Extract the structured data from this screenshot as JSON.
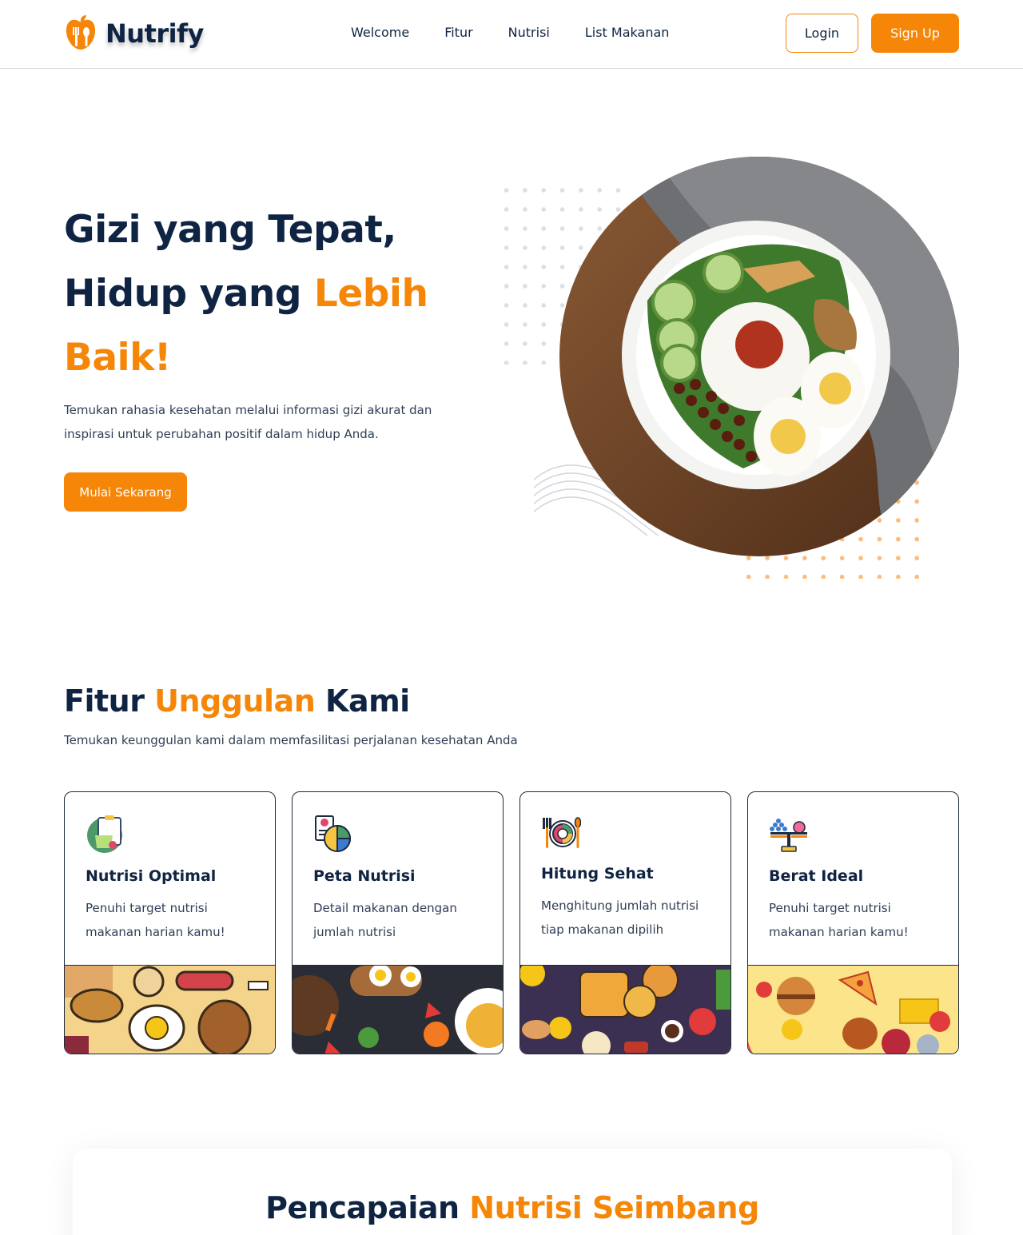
{
  "brand": {
    "name": "Nutrify",
    "logo_icon": "apple-fork-spoon-icon",
    "color_primary": "#0f2342",
    "color_accent": "#f58608"
  },
  "nav": {
    "links": [
      {
        "label": "Welcome"
      },
      {
        "label": "Fitur"
      },
      {
        "label": "Nutrisi"
      },
      {
        "label": "List Makanan"
      }
    ]
  },
  "auth": {
    "login_label": "Login",
    "signup_label": "Sign Up"
  },
  "hero": {
    "title_line1": "Gizi yang Tepat,",
    "title_line2_prefix": "Hidup yang ",
    "title_line2_accent": "Lebih",
    "title_line3_accent": "Baik!",
    "description": "Temukan rahasia kesehatan melalui informasi gizi akurat dan inspirasi untuk perubahan positif dalam hidup Anda.",
    "cta_label": "Mulai Sekarang",
    "image": "nasi-lemak-plate-photo"
  },
  "features": {
    "title_prefix": "Fitur ",
    "title_accent": "Unggulan",
    "title_suffix": " Kami",
    "subtitle": "Temukan keunggulan kami dalam memfasilitasi perjalanan kesehatan Anda",
    "cards": [
      {
        "title": "Nutrisi Optimal",
        "desc": "Penuhi target nutrisi makanan harian kamu!",
        "icon": "clipboard-salad-icon"
      },
      {
        "title": "Peta Nutrisi",
        "desc": "Detail makanan dengan jumlah nutrisi",
        "icon": "nutrition-chart-icon"
      },
      {
        "title": "Hitung Sehat",
        "desc": "Menghitung jumlah nutrisi tiap makanan dipilih",
        "icon": "plate-cutlery-icon"
      },
      {
        "title": "Berat Ideal",
        "desc": "Penuhi target nutrisi makanan harian kamu!",
        "icon": "balance-scale-icon"
      }
    ]
  },
  "achievement": {
    "title_prefix": "Pencapaian ",
    "title_accent": "Nutrisi Seimbang"
  }
}
